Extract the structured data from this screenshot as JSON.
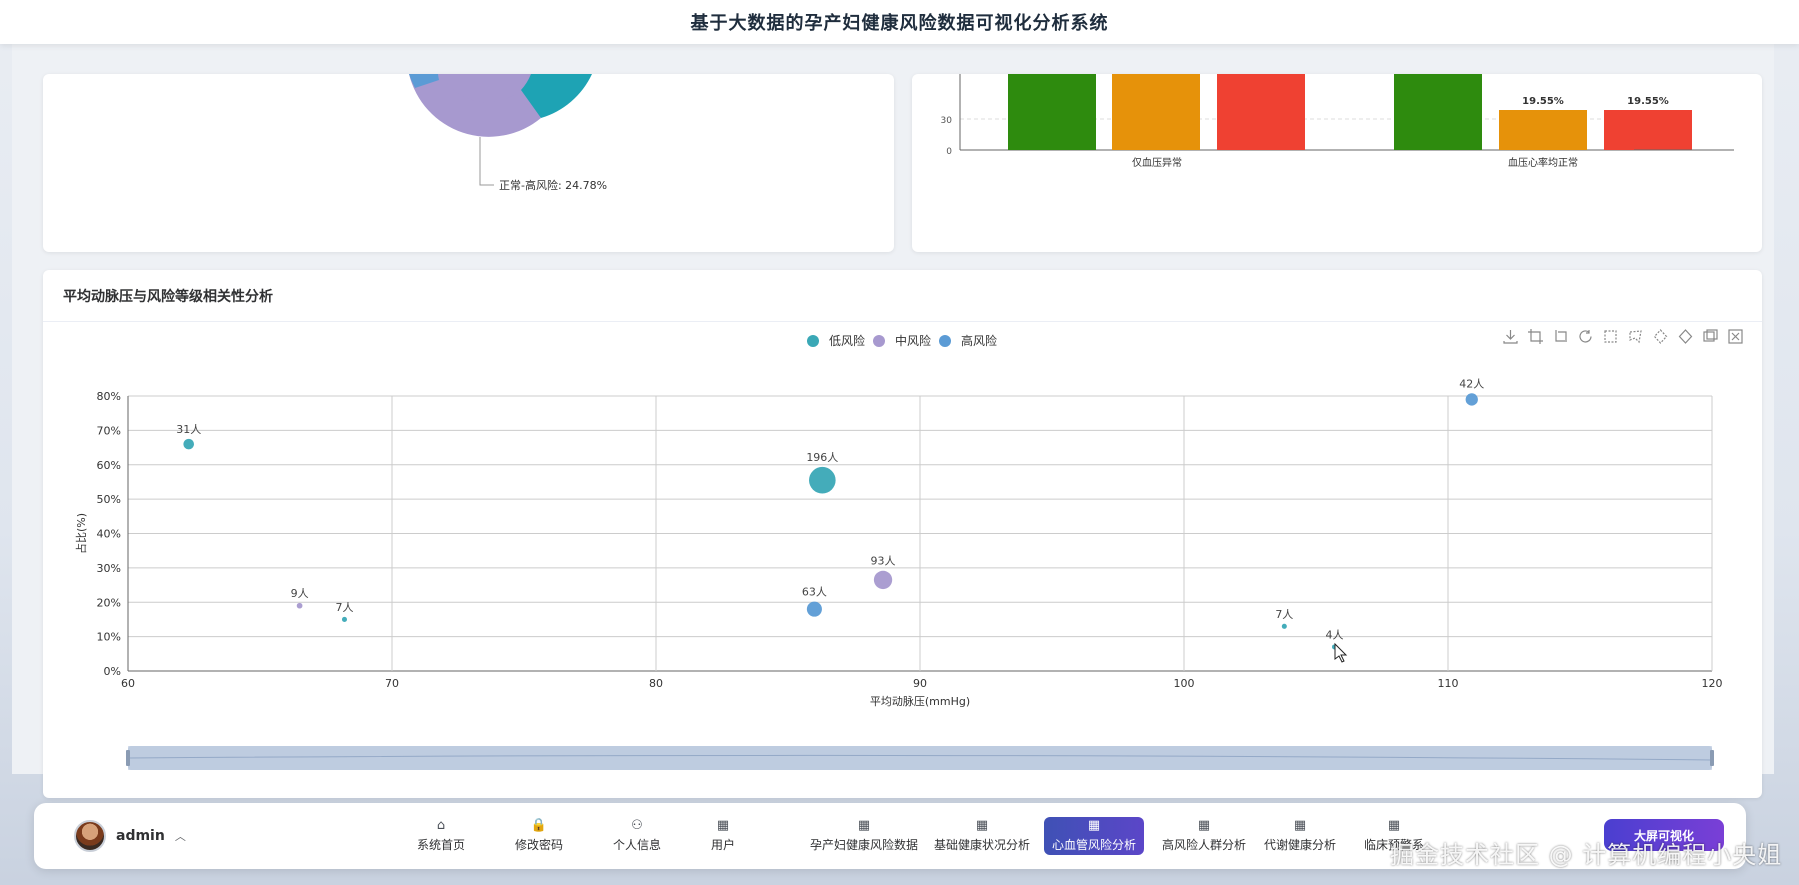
{
  "header": {
    "title": "基于大数据的孕产妇健康风险数据可视化分析系统"
  },
  "pie_card": {
    "label": "正常-高风险: 24.78%"
  },
  "bar_card": {
    "y_ticks": [
      "30",
      "0"
    ],
    "categories": [
      "仅血压异常",
      "血压心率均正常"
    ],
    "labels": [
      "19.55%",
      "19.55%"
    ]
  },
  "scatter_card": {
    "title": "平均动脉压与风险等级相关性分析",
    "legend": [
      "低风险",
      "中风险",
      "高风险"
    ]
  },
  "chart_data": [
    {
      "type": "pie",
      "slices": [
        {
          "name": "正常-高风险",
          "percent": 24.78
        }
      ]
    },
    {
      "type": "bar",
      "categories": [
        "仅血压异常",
        "血压心率均正常"
      ],
      "series_values_partial": [
        19.55,
        19.55
      ],
      "yticks": [
        "0",
        "30"
      ]
    },
    {
      "type": "scatter",
      "xlabel": "平均动脉压(mmHg)",
      "ylabel": "占比(%)",
      "xlim": [
        60,
        120
      ],
      "ylim": [
        0,
        80
      ],
      "xticks": [
        60,
        70,
        80,
        90,
        100,
        110,
        120
      ],
      "yticks": [
        "0%",
        "10%",
        "20%",
        "30%",
        "40%",
        "50%",
        "60%",
        "70%",
        "80%"
      ],
      "series": [
        {
          "name": "低风险",
          "color": "#3aa8b6",
          "points": [
            {
              "x": 62.3,
              "y": 66,
              "count": 31,
              "label": "31人"
            },
            {
              "x": 86.3,
              "y": 55.5,
              "count": 196,
              "label": "196人"
            },
            {
              "x": 68.2,
              "y": 15,
              "count": 7,
              "label": "7人"
            },
            {
              "x": 103.8,
              "y": 13,
              "count": 7,
              "label": "7人"
            },
            {
              "x": 105.7,
              "y": 7,
              "count": 4,
              "label": "4人"
            }
          ]
        },
        {
          "name": "中风险",
          "color": "#a799cf",
          "points": [
            {
              "x": 66.5,
              "y": 19,
              "count": 9,
              "label": "9人"
            },
            {
              "x": 88.6,
              "y": 26.5,
              "count": 93,
              "label": "93人"
            }
          ]
        },
        {
          "name": "高风险",
          "color": "#5b9bd5",
          "points": [
            {
              "x": 86,
              "y": 18,
              "count": 63,
              "label": "63人"
            },
            {
              "x": 110.9,
              "y": 79,
              "count": 42,
              "label": "42人"
            }
          ]
        }
      ]
    }
  ],
  "nav": {
    "username": "admin",
    "items": [
      {
        "label": "系统首页",
        "icon": "⌂"
      },
      {
        "label": "修改密码",
        "icon": "🔒"
      },
      {
        "label": "个人信息",
        "icon": "⚇"
      },
      {
        "label": "用户",
        "icon": "▦"
      },
      {
        "label": "孕产妇健康风险数据",
        "icon": "▦"
      },
      {
        "label": "基础健康状况分析",
        "icon": "▦"
      },
      {
        "label": "心血管风险分析",
        "icon": "▦"
      },
      {
        "label": "高风险人群分析",
        "icon": "▦"
      },
      {
        "label": "代谢健康分析",
        "icon": "▦"
      },
      {
        "label": "临床预警系",
        "icon": "▦"
      }
    ],
    "big_screen": "大屏可视化"
  },
  "watermark": "掘金技术社区 @ 计算机编程小央姐"
}
